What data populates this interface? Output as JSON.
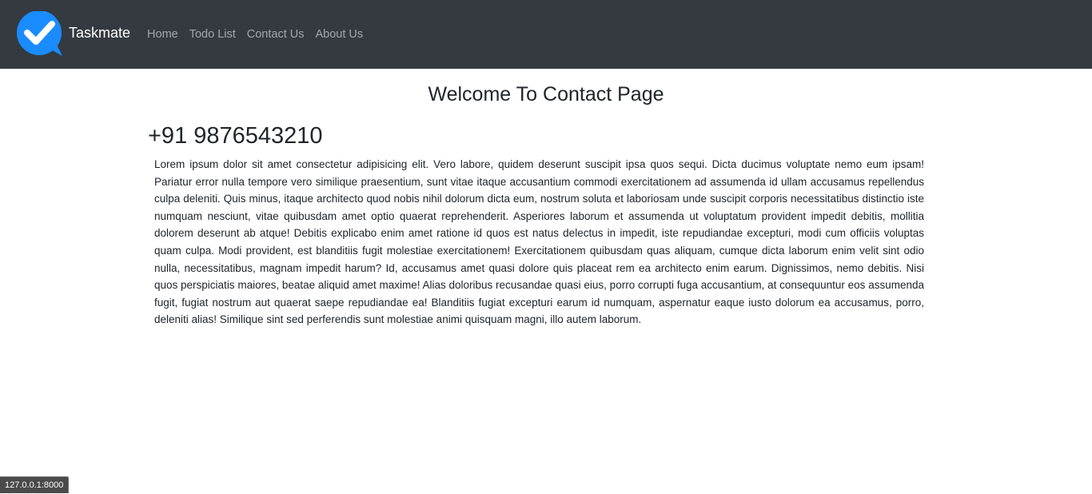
{
  "navbar": {
    "brand": "Taskmate",
    "brand_icon": "checkmark-speech-bubble-icon",
    "brand_color": "#1a8cff",
    "background": "#343a40",
    "links": [
      {
        "label": "Home"
      },
      {
        "label": "Todo List"
      },
      {
        "label": "Contact Us"
      },
      {
        "label": "About Us"
      }
    ]
  },
  "main": {
    "title": "Welcome To Contact Page",
    "phone": "+91 9876543210",
    "paragraph": "Lorem ipsum dolor sit amet consectetur adipisicing elit. Vero labore, quidem deserunt suscipit ipsa quos sequi. Dicta ducimus voluptate nemo eum ipsam! Pariatur error nulla tempore vero similique praesentium, sunt vitae itaque accusantium commodi exercitationem ad assumenda id ullam accusamus repellendus culpa deleniti. Quis minus, itaque architecto quod nobis nihil dolorum dicta eum, nostrum soluta et laboriosam unde suscipit corporis necessitatibus distinctio iste numquam nesciunt, vitae quibusdam amet optio quaerat reprehenderit. Asperiores laborum et assumenda ut voluptatum provident impedit debitis, mollitia dolorem deserunt ab atque! Debitis explicabo enim amet ratione id quos est natus delectus in impedit, iste repudiandae excepturi, modi cum officiis voluptas quam culpa. Modi provident, est blanditiis fugit molestiae exercitationem! Exercitationem quibusdam quas aliquam, cumque dicta laborum enim velit sint odio nulla, necessitatibus, magnam impedit harum? Id, accusamus amet quasi dolore quis placeat rem ea architecto enim earum. Dignissimos, nemo debitis. Nisi quos perspiciatis maiores, beatae aliquid amet maxime! Alias doloribus recusandae quasi eius, porro corrupti fuga accusantium, at consequuntur eos assumenda fugit, fugiat nostrum aut quaerat saepe repudiandae ea! Blanditiis fugiat excepturi earum id numquam, aspernatur eaque iusto dolorum ea accusamus, porro, deleniti alias! Similique sint sed perferendis sunt molestiae animi quisquam magni, illo autem laborum."
  },
  "status_bar": {
    "url": "127.0.0.1:8000"
  }
}
